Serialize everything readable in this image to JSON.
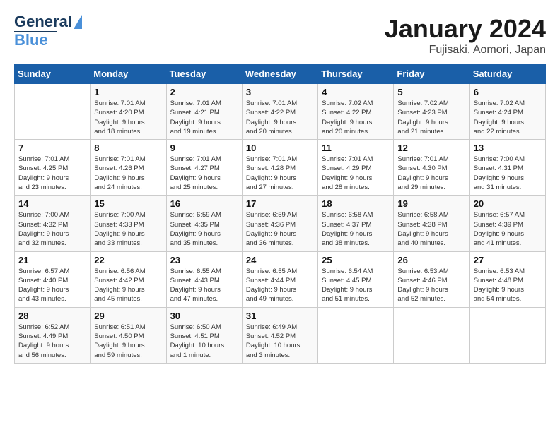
{
  "logo": {
    "line1": "General",
    "line2": "Blue"
  },
  "title": "January 2024",
  "location": "Fujisaki, Aomori, Japan",
  "days_of_week": [
    "Sunday",
    "Monday",
    "Tuesday",
    "Wednesday",
    "Thursday",
    "Friday",
    "Saturday"
  ],
  "weeks": [
    [
      {
        "day": "",
        "info": ""
      },
      {
        "day": "1",
        "info": "Sunrise: 7:01 AM\nSunset: 4:20 PM\nDaylight: 9 hours\nand 18 minutes."
      },
      {
        "day": "2",
        "info": "Sunrise: 7:01 AM\nSunset: 4:21 PM\nDaylight: 9 hours\nand 19 minutes."
      },
      {
        "day": "3",
        "info": "Sunrise: 7:01 AM\nSunset: 4:22 PM\nDaylight: 9 hours\nand 20 minutes."
      },
      {
        "day": "4",
        "info": "Sunrise: 7:02 AM\nSunset: 4:22 PM\nDaylight: 9 hours\nand 20 minutes."
      },
      {
        "day": "5",
        "info": "Sunrise: 7:02 AM\nSunset: 4:23 PM\nDaylight: 9 hours\nand 21 minutes."
      },
      {
        "day": "6",
        "info": "Sunrise: 7:02 AM\nSunset: 4:24 PM\nDaylight: 9 hours\nand 22 minutes."
      }
    ],
    [
      {
        "day": "7",
        "info": ""
      },
      {
        "day": "8",
        "info": "Sunrise: 7:01 AM\nSunset: 4:26 PM\nDaylight: 9 hours\nand 24 minutes."
      },
      {
        "day": "9",
        "info": "Sunrise: 7:01 AM\nSunset: 4:27 PM\nDaylight: 9 hours\nand 25 minutes."
      },
      {
        "day": "10",
        "info": "Sunrise: 7:01 AM\nSunset: 4:28 PM\nDaylight: 9 hours\nand 27 minutes."
      },
      {
        "day": "11",
        "info": "Sunrise: 7:01 AM\nSunset: 4:29 PM\nDaylight: 9 hours\nand 28 minutes."
      },
      {
        "day": "12",
        "info": "Sunrise: 7:01 AM\nSunset: 4:30 PM\nDaylight: 9 hours\nand 29 minutes."
      },
      {
        "day": "13",
        "info": "Sunrise: 7:00 AM\nSunset: 4:31 PM\nDaylight: 9 hours\nand 31 minutes."
      }
    ],
    [
      {
        "day": "14",
        "info": ""
      },
      {
        "day": "15",
        "info": "Sunrise: 7:00 AM\nSunset: 4:33 PM\nDaylight: 9 hours\nand 33 minutes."
      },
      {
        "day": "16",
        "info": "Sunrise: 6:59 AM\nSunset: 4:35 PM\nDaylight: 9 hours\nand 35 minutes."
      },
      {
        "day": "17",
        "info": "Sunrise: 6:59 AM\nSunset: 4:36 PM\nDaylight: 9 hours\nand 36 minutes."
      },
      {
        "day": "18",
        "info": "Sunrise: 6:58 AM\nSunset: 4:37 PM\nDaylight: 9 hours\nand 38 minutes."
      },
      {
        "day": "19",
        "info": "Sunrise: 6:58 AM\nSunset: 4:38 PM\nDaylight: 9 hours\nand 40 minutes."
      },
      {
        "day": "20",
        "info": "Sunrise: 6:57 AM\nSunset: 4:39 PM\nDaylight: 9 hours\nand 41 minutes."
      }
    ],
    [
      {
        "day": "21",
        "info": ""
      },
      {
        "day": "22",
        "info": "Sunrise: 6:56 AM\nSunset: 4:42 PM\nDaylight: 9 hours\nand 45 minutes."
      },
      {
        "day": "23",
        "info": "Sunrise: 6:55 AM\nSunset: 4:43 PM\nDaylight: 9 hours\nand 47 minutes."
      },
      {
        "day": "24",
        "info": "Sunrise: 6:55 AM\nSunset: 4:44 PM\nDaylight: 9 hours\nand 49 minutes."
      },
      {
        "day": "25",
        "info": "Sunrise: 6:54 AM\nSunset: 4:45 PM\nDaylight: 9 hours\nand 51 minutes."
      },
      {
        "day": "26",
        "info": "Sunrise: 6:53 AM\nSunset: 4:46 PM\nDaylight: 9 hours\nand 52 minutes."
      },
      {
        "day": "27",
        "info": "Sunrise: 6:53 AM\nSunset: 4:48 PM\nDaylight: 9 hours\nand 54 minutes."
      }
    ],
    [
      {
        "day": "28",
        "info": "Sunrise: 6:52 AM\nSunset: 4:49 PM\nDaylight: 9 hours\nand 56 minutes."
      },
      {
        "day": "29",
        "info": "Sunrise: 6:51 AM\nSunset: 4:50 PM\nDaylight: 9 hours\nand 59 minutes."
      },
      {
        "day": "30",
        "info": "Sunrise: 6:50 AM\nSunset: 4:51 PM\nDaylight: 10 hours\nand 1 minute."
      },
      {
        "day": "31",
        "info": "Sunrise: 6:49 AM\nSunset: 4:52 PM\nDaylight: 10 hours\nand 3 minutes."
      },
      {
        "day": "",
        "info": ""
      },
      {
        "day": "",
        "info": ""
      },
      {
        "day": "",
        "info": ""
      }
    ]
  ],
  "week7_sunday_info": "Sunrise: 7:01 AM\nSunset: 4:25 PM\nDaylight: 9 hours\nand 23 minutes.",
  "week14_sunday_info": "Sunrise: 7:00 AM\nSunset: 4:32 PM\nDaylight: 9 hours\nand 32 minutes.",
  "week21_sunday_info": "Sunrise: 6:57 AM\nSunset: 4:40 PM\nDaylight: 9 hours\nand 43 minutes."
}
